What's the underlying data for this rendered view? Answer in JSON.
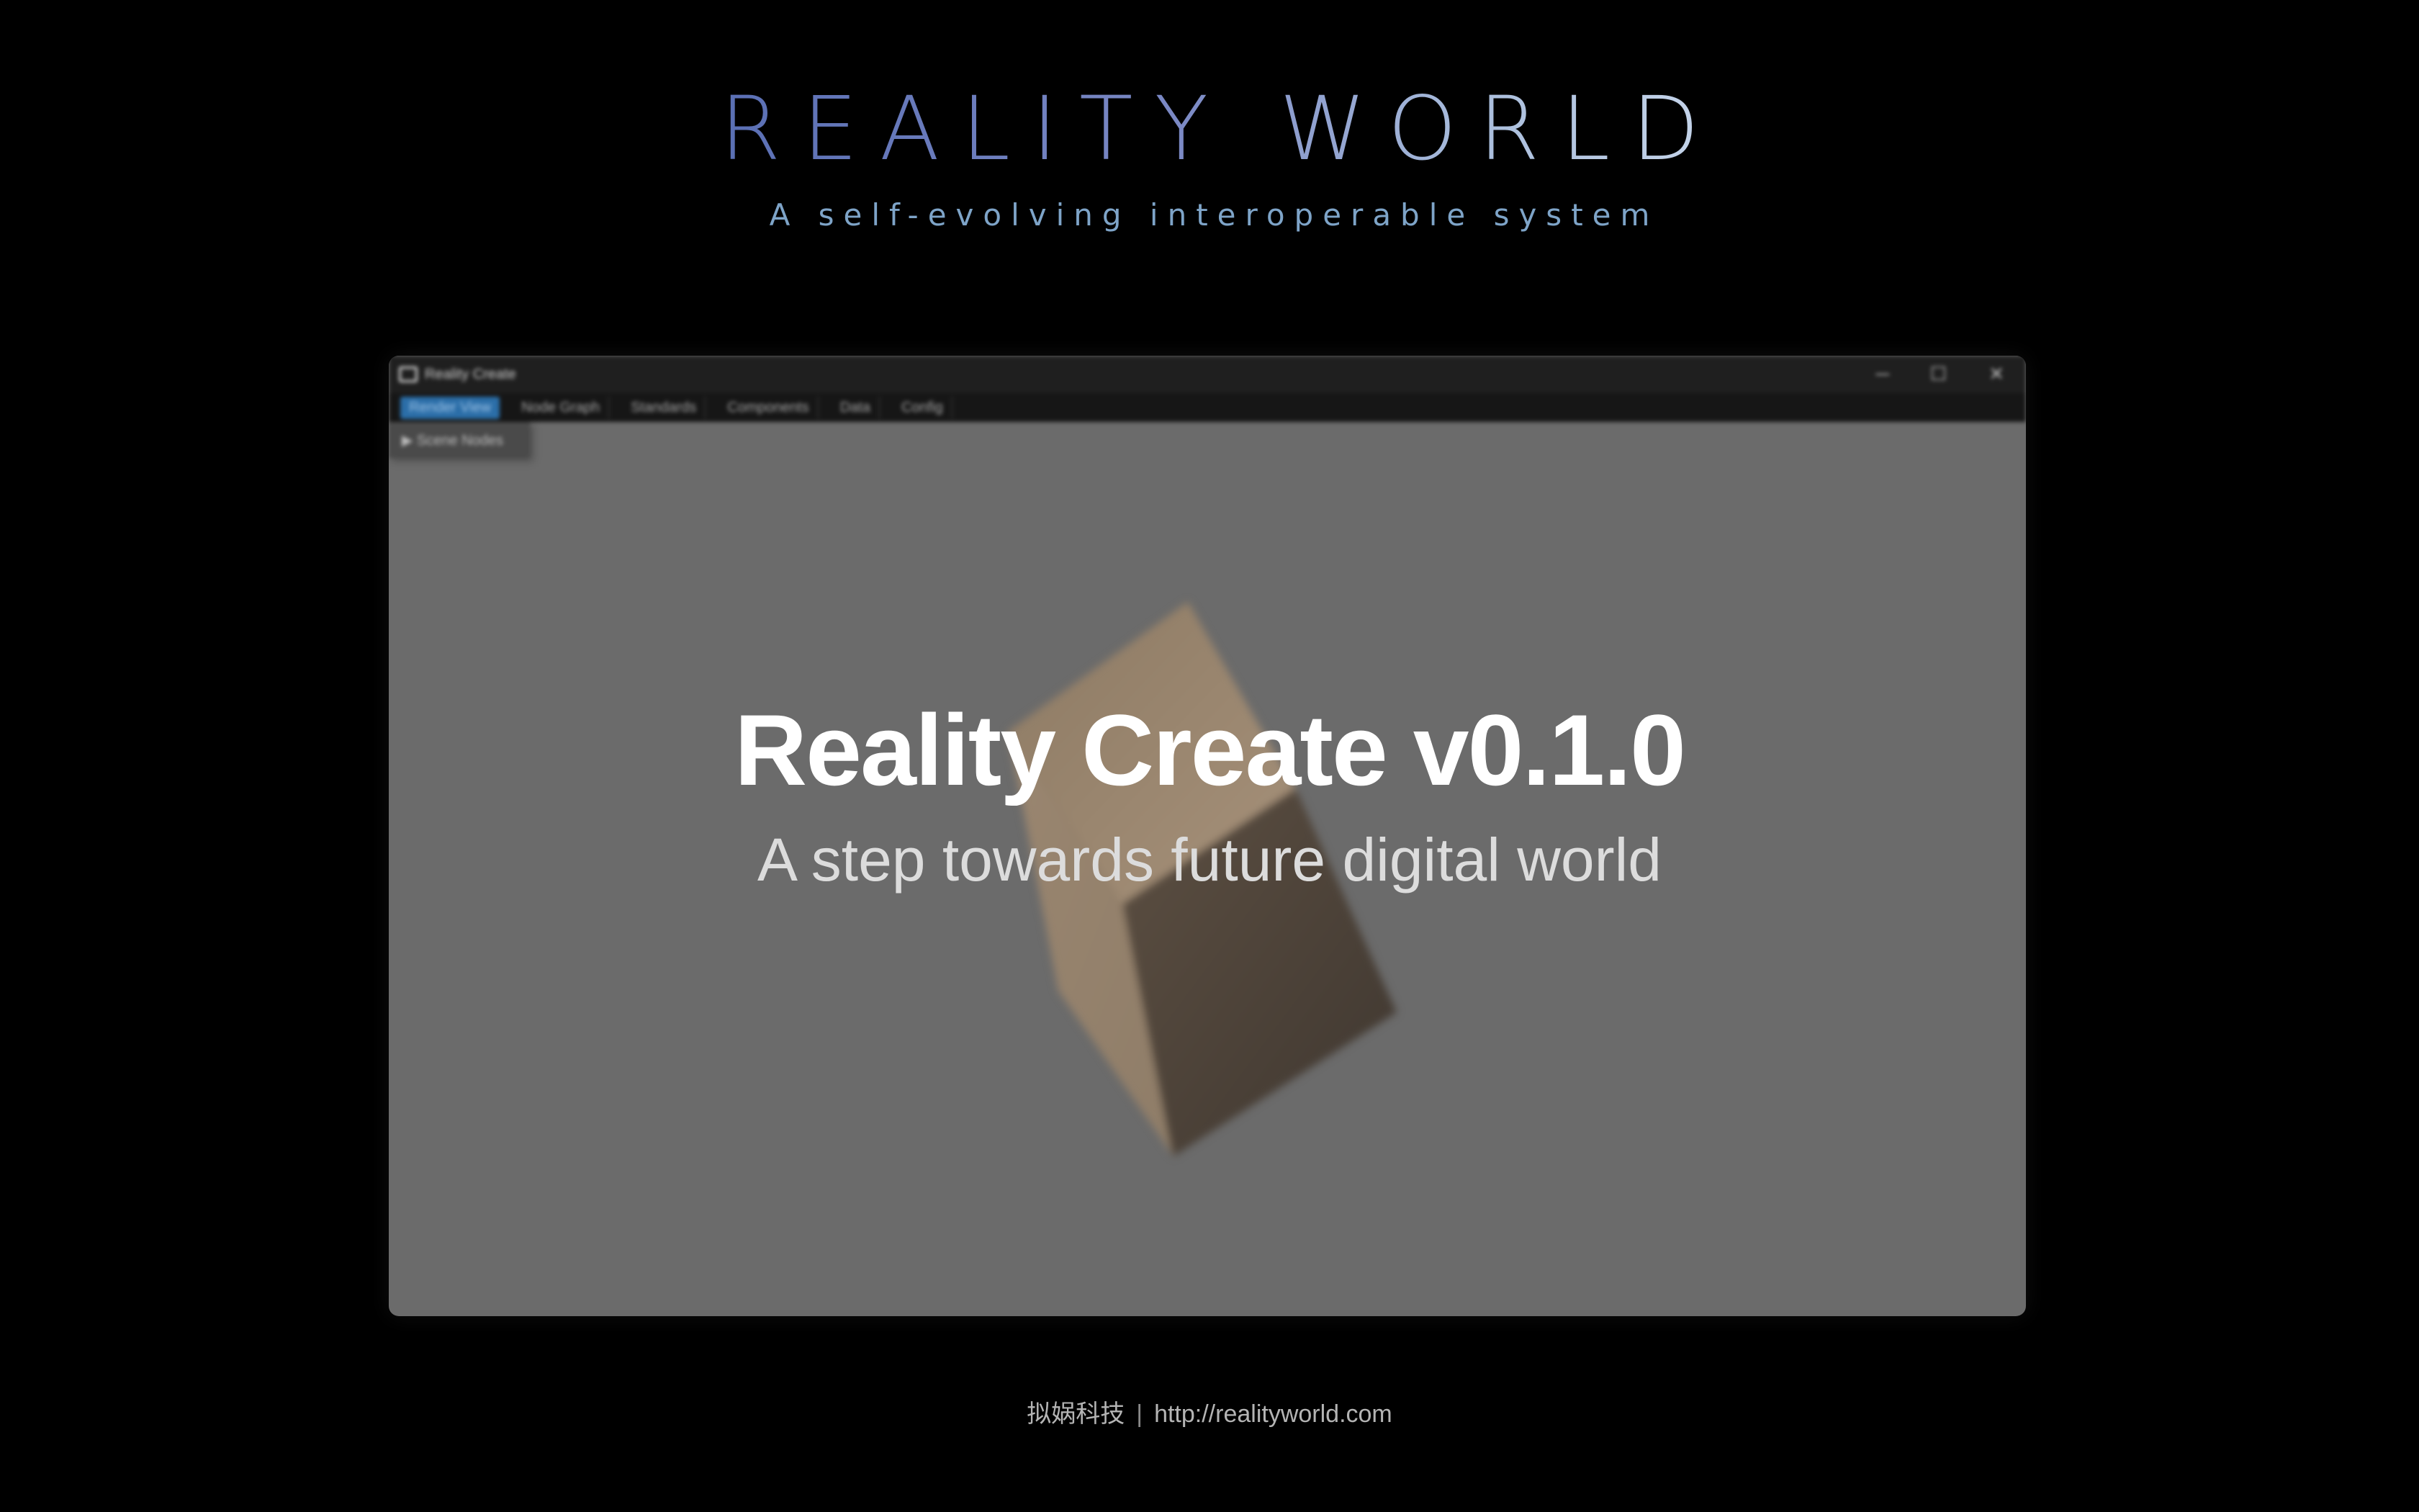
{
  "brand": {
    "logo": "REALITY WORLD",
    "tagline": "A self-evolving interoperable system"
  },
  "app_window": {
    "title": "Reality Create",
    "menu": [
      "Render View",
      "Node Graph",
      "Standards",
      "Components",
      "Data",
      "Config"
    ],
    "active_tab": "Render View",
    "panel_label": "▶ Scene Nodes",
    "controls": {
      "minimize": "─",
      "maximize": "☐",
      "close": "✕"
    }
  },
  "hero": {
    "title": "Reality Create v0.1.0",
    "subtitle": "A step towards future digital world"
  },
  "footer": {
    "company": "拟娲科技",
    "separator": "|",
    "url": "http://realityworld.com"
  },
  "colors": {
    "background": "#000000",
    "logo_gradient_start": "#5a6fb4",
    "logo_gradient_end": "#c6d5ea",
    "tagline": "#7ea4c8",
    "viewport": "#6b6b6b",
    "cube": "#a08c72",
    "active_tab": "#2b6ea8"
  }
}
